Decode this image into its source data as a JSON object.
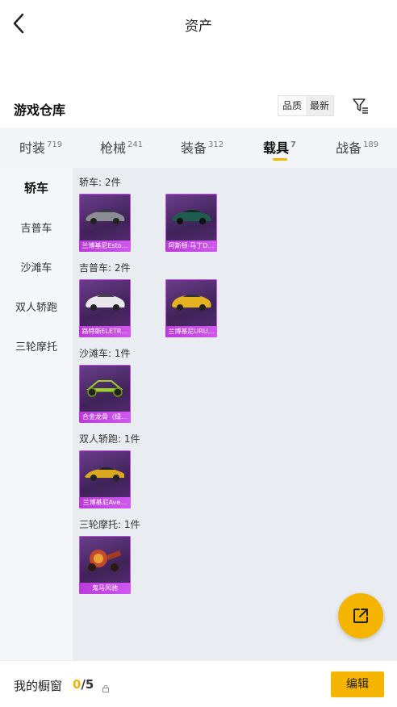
{
  "header": {
    "title": "资产"
  },
  "warehouse": {
    "title": "游戏仓库",
    "sort_options": [
      "品质",
      "最新"
    ]
  },
  "tabs": [
    {
      "label": "时装",
      "count": "719"
    },
    {
      "label": "枪械",
      "count": "241"
    },
    {
      "label": "装备",
      "count": "312"
    },
    {
      "label": "载具",
      "count": "7"
    },
    {
      "label": "战备",
      "count": "189"
    }
  ],
  "active_tab": "载具",
  "sidebar": {
    "items": [
      "轿车",
      "吉普车",
      "沙滩车",
      "双人轿跑",
      "三轮摩托"
    ],
    "active": "轿车"
  },
  "sections": [
    {
      "title": "轿车: 2件",
      "items": [
        {
          "name": "兰博基尼Esto…"
        },
        {
          "name": "阿斯顿·马丁D…"
        }
      ]
    },
    {
      "title": "吉普车: 2件",
      "items": [
        {
          "name": "路特斯ELETR…"
        },
        {
          "name": "兰博基尼URU…"
        }
      ]
    },
    {
      "title": "沙滩车: 1件",
      "items": [
        {
          "name": "合金龙骨（绿…"
        }
      ]
    },
    {
      "title": "双人轿跑: 1件",
      "items": [
        {
          "name": "兰博基尼Ave…"
        }
      ]
    },
    {
      "title": "三轮摩托: 1件",
      "items": [
        {
          "name": "鬼马风驰"
        }
      ]
    }
  ],
  "bottom": {
    "showcase_label": "我的橱窗",
    "current": "0",
    "total": "/5",
    "edit_label": "编辑"
  },
  "colors": {
    "accent": "#f5b400",
    "card_purple": "#5a2d78",
    "card_border": "#c04fe0"
  },
  "icons": {
    "back": "back-arrow-icon",
    "filter": "filter-icon",
    "share": "share-external-icon",
    "lock": "lock-icon"
  }
}
